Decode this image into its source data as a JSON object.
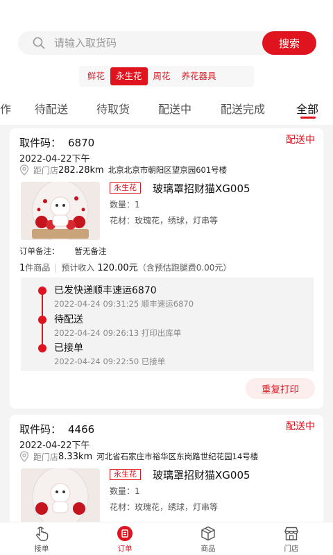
{
  "search": {
    "placeholder": "请输入取货码",
    "button": "搜索"
  },
  "category_tabs": [
    {
      "label": "鲜花",
      "active": false
    },
    {
      "label": "永生花",
      "active": true
    },
    {
      "label": "周花",
      "active": false
    },
    {
      "label": "养花器具",
      "active": false
    }
  ],
  "status_tabs": [
    {
      "label": "作",
      "active": false
    },
    {
      "label": "待配送",
      "active": false
    },
    {
      "label": "待取货",
      "active": false
    },
    {
      "label": "配送中",
      "active": false
    },
    {
      "label": "配送完成",
      "active": false
    },
    {
      "label": "全部",
      "active": true
    }
  ],
  "orders": [
    {
      "pickup_label": "取件码：",
      "pickup_code": "6870",
      "status": "配送中",
      "date": "2022-04-22下午",
      "distance_label": "距门店",
      "distance": "282.28km",
      "address": "北京北京市朝阳区望京园601号楼",
      "tag": "永生花",
      "product_name": "玻璃罩招财猫XG005",
      "quantity": "数量：1",
      "flowers": "花材：玫瑰花，绣球，灯串等",
      "note_label": "订单备注：",
      "note_value": "暂无备注",
      "item_count": "1",
      "item_unit": "件商品",
      "income_label": "预计收入",
      "income": "120.00元",
      "income_note": "（含预估跑腿费0.00元）",
      "timeline": [
        {
          "title": "已发快递顺丰速运6870",
          "time": "2022-04-24 09:31:25 顺丰速运6870"
        },
        {
          "title": "待配送",
          "time": "2022-04-24 09:26:13 打印出库单"
        },
        {
          "title": "已接单",
          "time": "2022-04-24 09:22:50 已接单"
        }
      ],
      "reprint": "重复打印"
    },
    {
      "pickup_label": "取件码：",
      "pickup_code": "4466",
      "status": "配送中",
      "date": "2022-04-22下午",
      "distance_label": "距门店",
      "distance": "8.33km",
      "address": "河北省石家庄市裕华区东岗路世纪花园14号楼",
      "tag": "永生花",
      "product_name": "玻璃罩招财猫XG005",
      "quantity": "数量：1",
      "flowers": "花材：玫瑰花，绣球，灯串等"
    }
  ],
  "bottom_nav": [
    {
      "label": "接单",
      "icon": "hand-tap-icon",
      "active": false
    },
    {
      "label": "订单",
      "icon": "order-icon",
      "active": true
    },
    {
      "label": "商品",
      "icon": "box-icon",
      "active": false
    },
    {
      "label": "门店",
      "icon": "store-icon",
      "active": false
    }
  ],
  "colors": {
    "accent": "#e0141e",
    "background": "#f4f4f4"
  }
}
